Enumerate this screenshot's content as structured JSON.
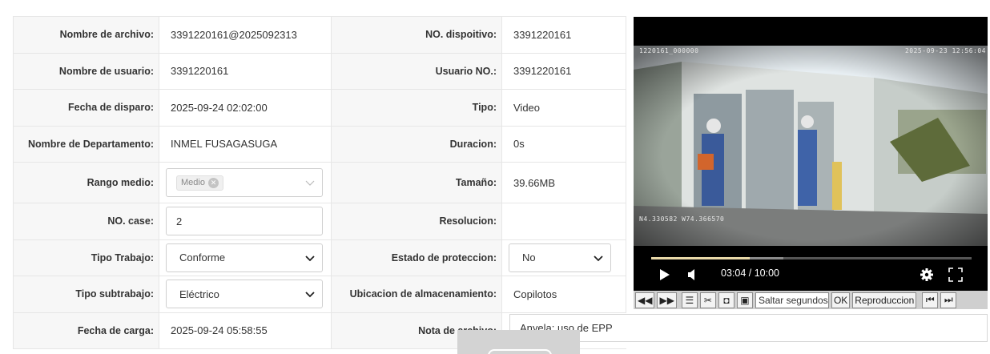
{
  "rows": [
    {
      "l1": "Nombre de archivo:",
      "v1": "3391220161@2025092313",
      "l2": "NO. dispoitivo:",
      "v2": "3391220161"
    },
    {
      "l1": "Nombre de usuario:",
      "v1": "3391220161",
      "l2": "Usuario NO.:",
      "v2": "3391220161"
    },
    {
      "l1": "Fecha de disparo:",
      "v1": "2025-09-24 02:02:00",
      "l2": "Tipo:",
      "v2": "Video"
    },
    {
      "l1": "Nombre de Departamento:",
      "v1": "INMEL FUSAGASUGA",
      "l2": "Duracion:",
      "v2": "0s"
    },
    {
      "l1": "Rango medio:",
      "v1": "Medio",
      "l2": "Tamaño:",
      "v2": "39.66MB"
    },
    {
      "l1": "NO. case:",
      "v1": "2",
      "l2": "Resolucion:",
      "v2": ""
    },
    {
      "l1": "Tipo Trabajo:",
      "v1": "Conforme",
      "l2": "Estado de proteccion:",
      "v2": "No"
    },
    {
      "l1": "Tipo subtrabajo:",
      "v1": "Eléctrico",
      "l2": "Ubicacion de almacenamiento:",
      "v2": "Copilotos"
    },
    {
      "l1": "Fecha de carga:",
      "v1": "2025-09-24 05:58:55",
      "l2": "Nota de archivo:",
      "v2": "Anyela: uso de EPP"
    }
  ],
  "video": {
    "osd_id": "1220161_000000",
    "osd_datetime": "2025-09-23  12:56:04",
    "osd_gps": "N4.330582  W74.366570",
    "current_time": "03:04 / 10:00",
    "progress": 0.3067
  },
  "toolbar": {
    "skip_placeholder": "Saltar segundos",
    "ok_label": "OK",
    "playback_label": "Reproduccion"
  },
  "colors": {
    "label_bg": "#f7f7f7",
    "border": "#e6e6e6",
    "player_bg": "#000000",
    "progress_played": "#e8d8a8"
  }
}
